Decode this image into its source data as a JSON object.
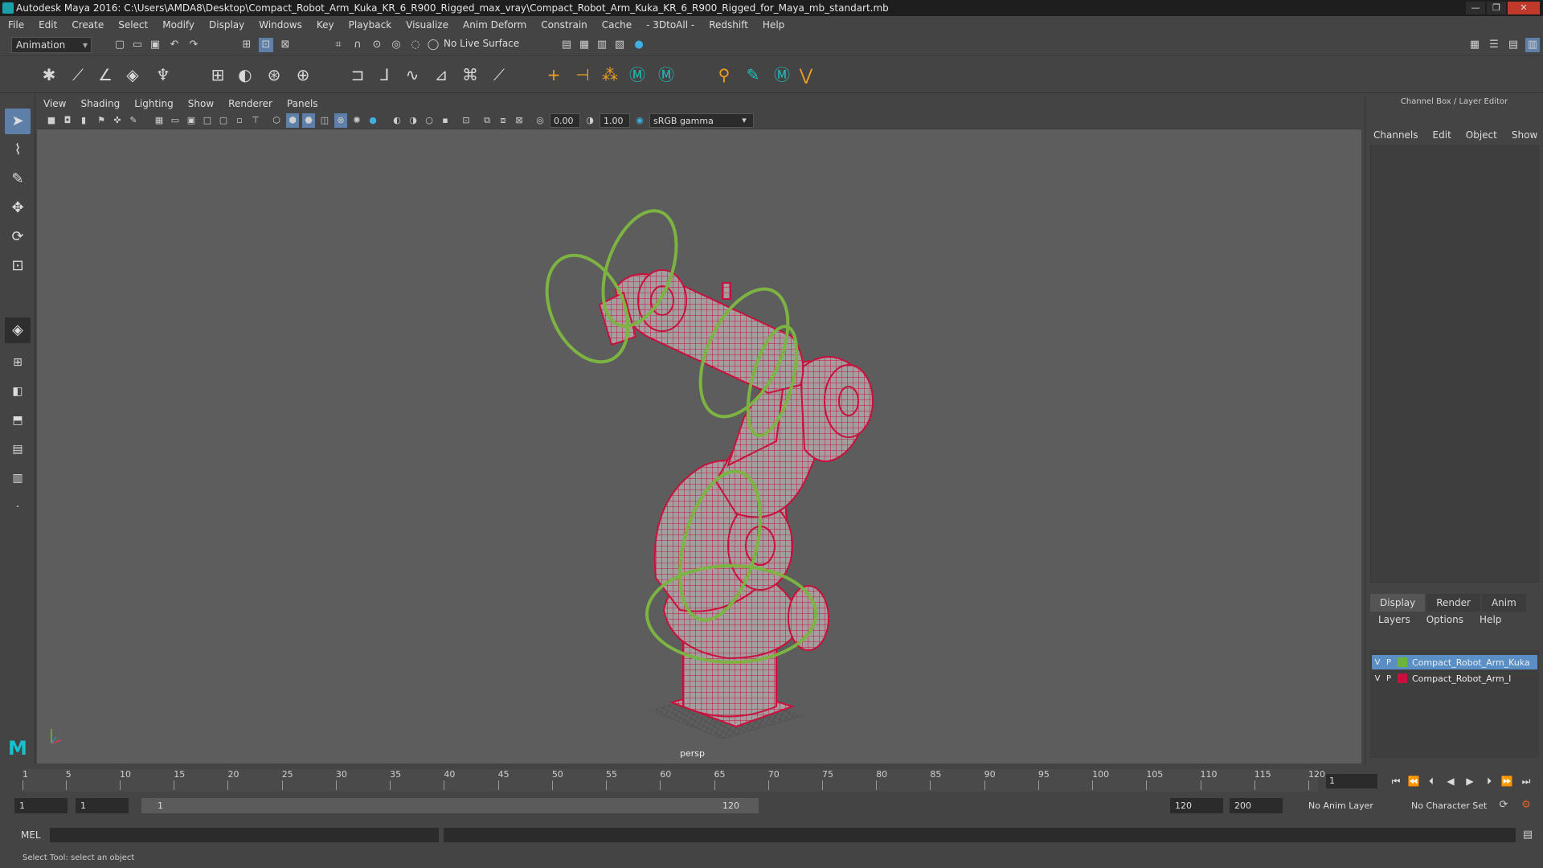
{
  "window": {
    "title": "Autodesk Maya 2016: C:\\Users\\AMDA8\\Desktop\\Compact_Robot_Arm_Kuka_KR_6_R900_Rigged_max_vray\\Compact_Robot_Arm_Kuka_KR_6_R900_Rigged_for_Maya_mb_standart.mb"
  },
  "menubar": [
    "File",
    "Edit",
    "Create",
    "Select",
    "Modify",
    "Display",
    "Windows",
    "Key",
    "Playback",
    "Visualize",
    "Anim Deform",
    "Constrain",
    "Cache",
    "- 3DtoAll -",
    "Redshift",
    "Help"
  ],
  "toolbar": {
    "mode": "Animation",
    "live_surface": "No Live Surface"
  },
  "viewport": {
    "menu": [
      "View",
      "Shading",
      "Lighting",
      "Show",
      "Renderer",
      "Panels"
    ],
    "exposure": "0.00",
    "gamma": "1.00",
    "color_space": "sRGB gamma",
    "camera_label": "persp"
  },
  "channel_box": {
    "title": "Channel Box / Layer Editor",
    "menu": [
      "Channels",
      "Edit",
      "Object",
      "Show"
    ]
  },
  "layer_editor": {
    "tabs": [
      "Display",
      "Render",
      "Anim"
    ],
    "menu": [
      "Layers",
      "Options",
      "Help"
    ],
    "layers": [
      {
        "v": "V",
        "p": "P",
        "color": "#6db33f",
        "name": "Compact_Robot_Arm_Kuka",
        "selected": true
      },
      {
        "v": "V",
        "p": "P",
        "color": "#c8103c",
        "name": "Compact_Robot_Arm_I",
        "selected": false
      }
    ]
  },
  "timeline": {
    "ticks": [
      "1",
      "5",
      "10",
      "15",
      "20",
      "25",
      "30",
      "35",
      "40",
      "45",
      "50",
      "55",
      "60",
      "65",
      "70",
      "75",
      "80",
      "85",
      "90",
      "95",
      "100",
      "105",
      "110",
      "115",
      "120"
    ],
    "current_frame": "1"
  },
  "range": {
    "start": "1",
    "playback_start": "1",
    "slider_start": "1",
    "slider_end": "120",
    "playback_end": "120",
    "end": "200",
    "anim_layer": "No Anim Layer",
    "character_set": "No Character Set"
  },
  "mel": {
    "label": "MEL"
  },
  "status": {
    "text": "Select Tool: select an object"
  },
  "colors": {
    "rig_controls": "#7cb342",
    "mesh_wire": "#c8103c",
    "mesh_fill": "#9a9a9a"
  }
}
